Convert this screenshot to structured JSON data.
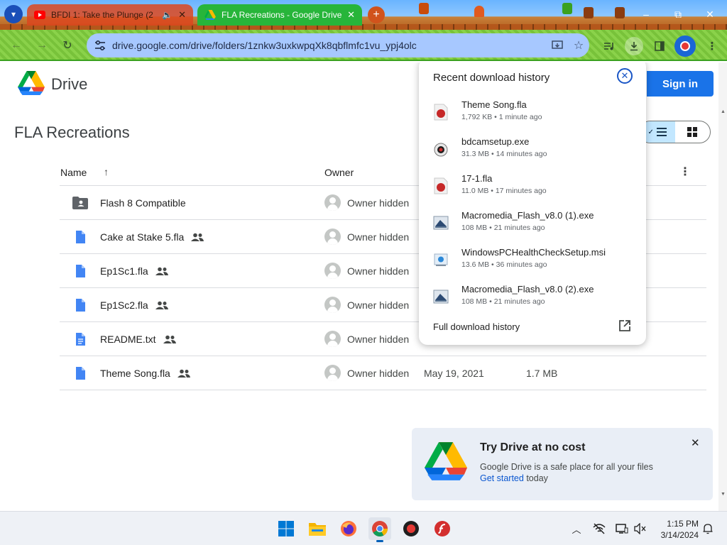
{
  "browser": {
    "tabs": [
      {
        "title": "BFDI 1: Take the Plunge (2",
        "active": false
      },
      {
        "title": "FLA Recreations - Google Drive",
        "active": true
      }
    ],
    "new_tab_label": "+",
    "address": "drive.google.com/drive/folders/1znkw3uxkwpqXk8qbflmfc1vu_ypj4olc",
    "window_controls": {
      "minimize": "–",
      "restore": "⧉",
      "close": "✕"
    }
  },
  "drive": {
    "app_name": "Drive",
    "sign_in_label": "Sign in",
    "folder_title": "FLA Recreations",
    "columns": {
      "name": "Name",
      "owner": "Owner"
    },
    "files": [
      {
        "name": "Flash 8 Compatible",
        "type": "shared-folder",
        "shared": false,
        "owner": "Owner hidden",
        "modified": "",
        "size": ""
      },
      {
        "name": "Cake at Stake 5.fla",
        "type": "file",
        "shared": true,
        "owner": "Owner hidden",
        "modified": "",
        "size": ""
      },
      {
        "name": "Ep1Sc1.fla",
        "type": "file",
        "shared": true,
        "owner": "Owner hidden",
        "modified": "",
        "size": ""
      },
      {
        "name": "Ep1Sc2.fla",
        "type": "file",
        "shared": true,
        "owner": "Owner hidden",
        "modified": "",
        "size": ""
      },
      {
        "name": "README.txt",
        "type": "doc",
        "shared": true,
        "owner": "Owner hidden",
        "modified": "",
        "size": ""
      },
      {
        "name": "Theme Song.fla",
        "type": "file",
        "shared": true,
        "owner": "Owner hidden",
        "modified": "May 19, 2021",
        "size": "1.7 MB"
      }
    ]
  },
  "downloads": {
    "title": "Recent download history",
    "items": [
      {
        "name": "Theme Song.fla",
        "meta": "1,792 KB • 1 minute ago",
        "icon": "fla-icon"
      },
      {
        "name": "bdcamsetup.exe",
        "meta": "31.3 MB • 14 minutes ago",
        "icon": "bandicam-icon"
      },
      {
        "name": "17-1.fla",
        "meta": "11.0 MB • 17 minutes ago",
        "icon": "fla-icon"
      },
      {
        "name": "Macromedia_Flash_v8.0 (1).exe",
        "meta": "108 MB • 21 minutes ago",
        "icon": "installer-icon"
      },
      {
        "name": "WindowsPCHealthCheckSetup.msi",
        "meta": "13.6 MB • 36 minutes ago",
        "icon": "msi-icon"
      },
      {
        "name": "Macromedia_Flash_v8.0 (2).exe",
        "meta": "108 MB • 21 minutes ago",
        "icon": "installer-icon"
      }
    ],
    "full_history_label": "Full download history"
  },
  "toast": {
    "title": "Try Drive at no cost",
    "body": "Google Drive is a safe place for all your files",
    "link": "Get started",
    "suffix": " today"
  },
  "taskbar": {
    "time": "1:15 PM",
    "date": "3/14/2024"
  },
  "colors": {
    "drive_blue": "#1a73e8",
    "active_tab": "#27b53a",
    "omnibox": "#a7c8ff",
    "list_view_selected": "#c2e7ff"
  }
}
